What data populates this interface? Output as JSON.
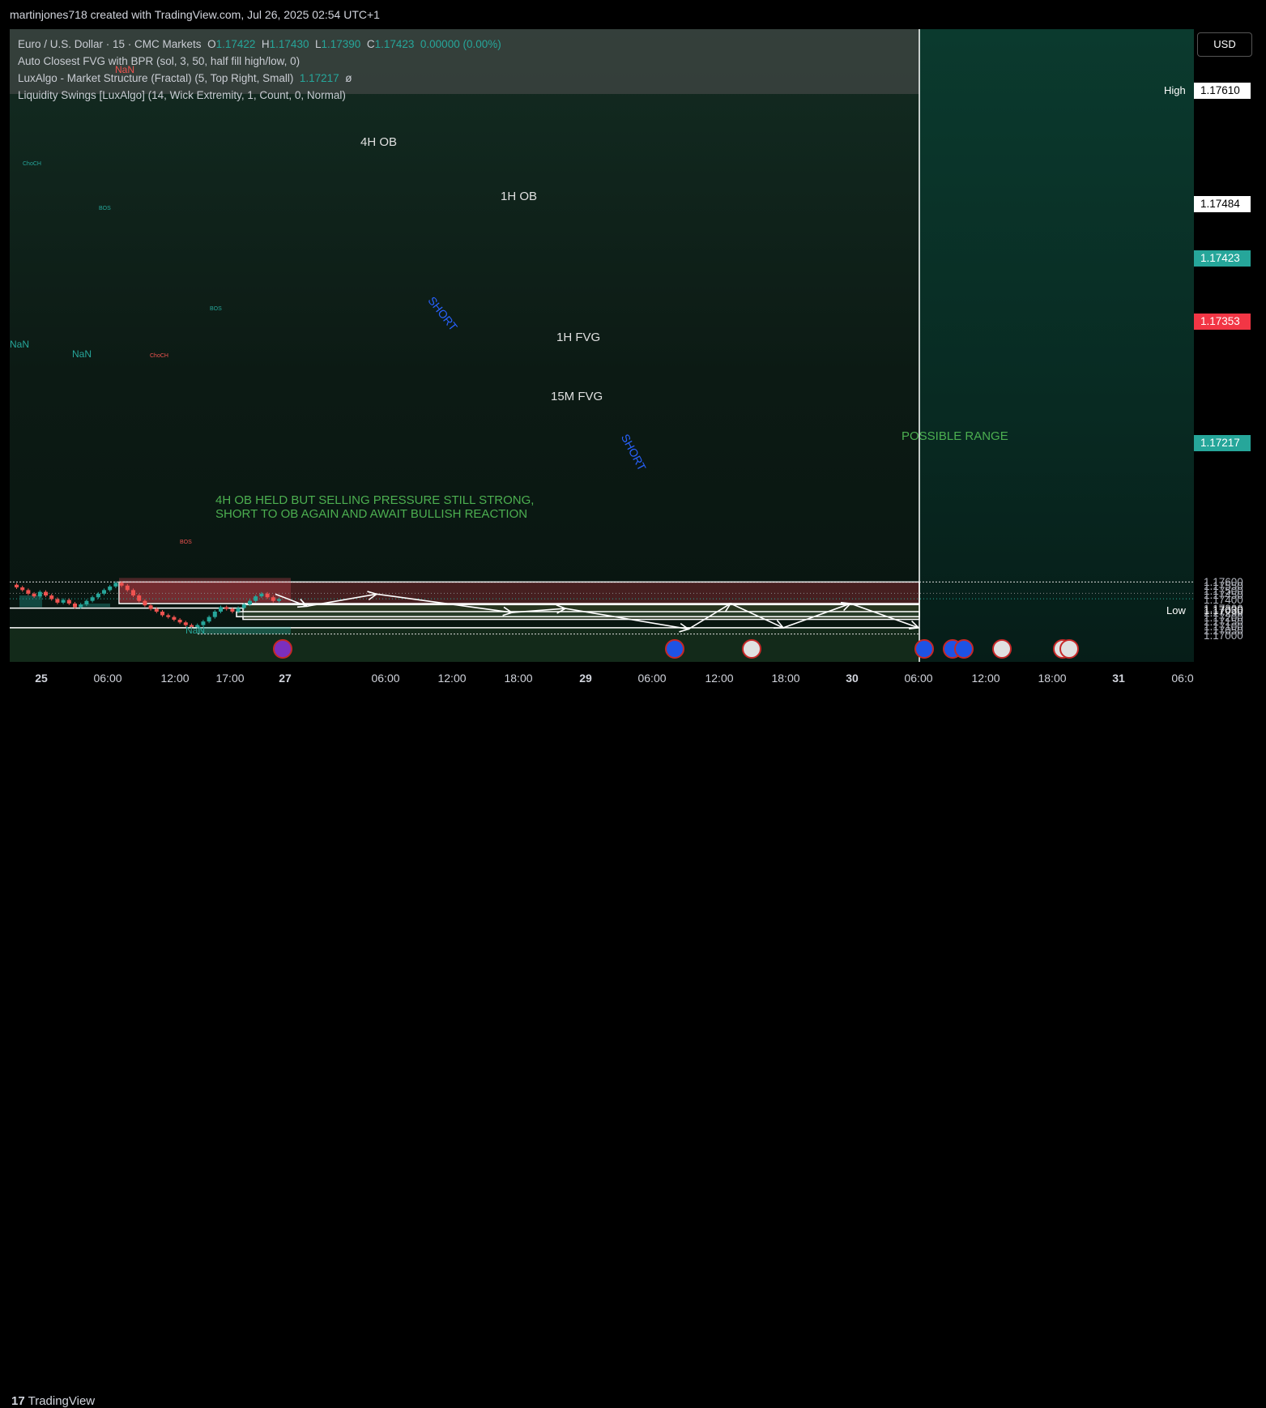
{
  "header": {
    "credit": "martinjones718 created with TradingView.com, Jul 26, 2025 02:54 UTC+1"
  },
  "legend": {
    "symbol_line": {
      "symbol": "Euro / U.S. Dollar · 15 · CMC Markets",
      "o_label": "O",
      "o": "1.17422",
      "h_label": "H",
      "h": "1.17430",
      "l_label": "L",
      "l": "1.17390",
      "c_label": "C",
      "c": "1.17423",
      "change": "0.00000 (0.00%)"
    },
    "indicators": [
      {
        "label": "Auto Closest FVG with BPR (sol, 3, 50, half fill high/low, 0)",
        "value": ""
      },
      {
        "label": "LuxAlgo - Market Structure (Fractal) (5, Top Right, Small)",
        "value": "1.17217",
        "suffix": "ø"
      },
      {
        "label": "Liquidity Swings [LuxAlgo] (14, Wick Extremity, 1, Count, 0, Normal)",
        "value": ""
      }
    ]
  },
  "currency_button": "USD",
  "price_axis": {
    "ticks": [
      "1.17600",
      "1.17550",
      "1.17500",
      "1.17450",
      "1.17400",
      "1.17300",
      "1.17250",
      "1.17200",
      "1.17150",
      "1.17100",
      "1.17050",
      "1.17000"
    ],
    "high_label": "High",
    "high_value": "1.17610",
    "low_label": "Low",
    "low_value": "1.17030",
    "badges": [
      {
        "value": "1.17484",
        "style": "white"
      },
      {
        "value": "1.17423",
        "style": "green"
      },
      {
        "value": "1.17353",
        "style": "red"
      },
      {
        "value": "1.17217",
        "style": "green"
      }
    ]
  },
  "time_axis": [
    "25",
    "06:00",
    "12:00",
    "17:00",
    "27",
    "06:00",
    "12:00",
    "18:00",
    "29",
    "06:00",
    "12:00",
    "18:00",
    "30",
    "06:00",
    "12:00",
    "18:00",
    "31",
    "06:0"
  ],
  "annotations": {
    "ob_4h": "4H OB",
    "ob_1h": "1H OB",
    "fvg_1h": "1H FVG",
    "fvg_15m": "15M FVG",
    "short_1": "SHORT",
    "short_2": "SHORT",
    "possible_range": "POSSIBLE RANGE",
    "note_line1": "4H OB HELD BUT SELLING PRESSURE STILL STRONG,",
    "note_line2": "SHORT TO OB AGAIN AND AWAIT BULLISH REACTION"
  },
  "small_labels": {
    "nan": "NaN",
    "bos": "BOS",
    "choch": "ChoCH"
  },
  "footer": {
    "brand": "TradingView"
  },
  "colors": {
    "up": "#26a69a",
    "down": "#ef5350",
    "ob_zone": "#5a2a2c",
    "fvg_zone": "#3a4530",
    "note_text": "#4caf50",
    "short_text": "#2962ff"
  },
  "chart_data": {
    "type": "candlestick",
    "symbol": "Euro / U.S. Dollar",
    "timeframe": "15",
    "ylim": [
      1.1696,
      1.1765
    ],
    "zones": [
      {
        "name": "4H OB",
        "from": 1.1737,
        "to": 1.1761
      },
      {
        "name": "1H FVG",
        "from": 1.1732,
        "to": 1.17355
      },
      {
        "name": "15M FVG",
        "from": 1.1726,
        "to": 1.1728
      }
    ],
    "levels": [
      1.1761,
      1.17484,
      1.17423,
      1.17353,
      1.17217,
      1.171,
      1.1703
    ],
    "projected_path": [
      1.17475,
      1.1734,
      1.17475,
      1.1727,
      1.17315,
      1.17085,
      1.1737,
      1.171,
      1.1737,
      1.171
    ],
    "closes_approx": [
      1.1755,
      1.1752,
      1.1748,
      1.1745,
      1.175,
      1.1746,
      1.1742,
      1.1738,
      1.1741,
      1.1737,
      1.1733,
      1.1736,
      1.174,
      1.1744,
      1.1748,
      1.1752,
      1.1756,
      1.176,
      1.1757,
      1.1752,
      1.1746,
      1.174,
      1.1735,
      1.1731,
      1.1728,
      1.1724,
      1.1722,
      1.1719,
      1.1716,
      1.1713,
      1.1711,
      1.1713,
      1.1717,
      1.1722,
      1.1728,
      1.1733,
      1.1731,
      1.1728,
      1.1732,
      1.1736,
      1.174,
      1.1745,
      1.1748,
      1.1744,
      1.174,
      1.1742
    ]
  }
}
